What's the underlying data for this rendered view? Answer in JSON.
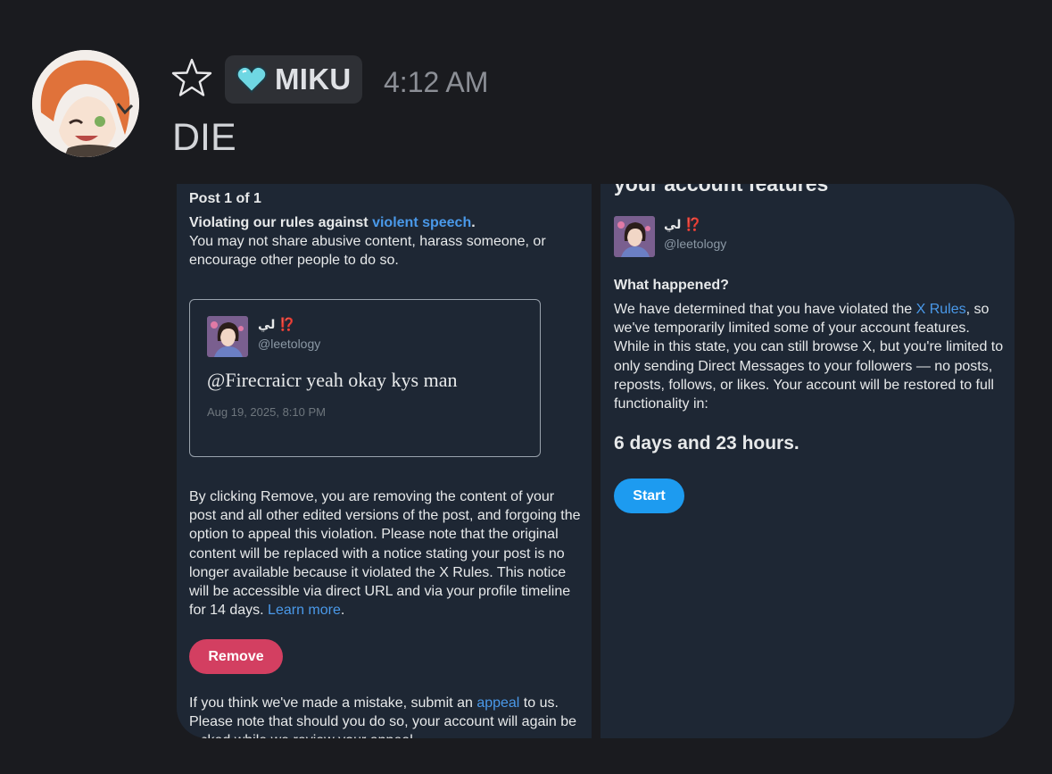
{
  "message": {
    "role_tag": "MIKU",
    "timestamp": "4:12 AM",
    "text": "DIE"
  },
  "left_panel": {
    "post_count": "Post 1 of 1",
    "violation_prefix": "Violating our rules against ",
    "violation_link": "violent speech",
    "violation_suffix": ".",
    "violation_desc": "You may not share abusive content, harass someone, or encourage other people to do so.",
    "tweet": {
      "name": "لي ⁉️",
      "handle": "@leetology",
      "text": "@Firecraicr yeah okay kys man",
      "date": "Aug 19, 2025, 8:10 PM"
    },
    "remove_info": "By clicking Remove, you are removing the content of your post and all other edited versions of the post, and forgoing the option to appeal this violation. Please note that the original content will be replaced with a notice stating your post is no longer available because it violated the X Rules. This notice will be accessible via direct URL and via your profile timeline for 14 days. ",
    "learn_more": "Learn more",
    "learn_more_suffix": ".",
    "remove_label": "Remove",
    "appeal_prefix": "If you think we've made a mistake, submit an ",
    "appeal_link": "appeal",
    "appeal_suffix": " to us. Please note that should you do so, your account will again be locked while we review your appeal."
  },
  "right_panel": {
    "cut_heading": "your account features",
    "name": "لي ⁉️",
    "handle": "@leetology",
    "what_happened": "What happened?",
    "explanation_prefix": "We have determined that you have violated the ",
    "rules_link": "X Rules",
    "explanation_suffix": ", so we've temporarily limited some of your account features. While in this state, you can still browse X, but you're limited to only sending Direct Messages to your followers — no posts, reposts, follows, or likes. Your account will be restored to full functionality in:",
    "duration": "6 days and 23 hours.",
    "start_label": "Start"
  },
  "colors": {
    "link": "#4a99e9",
    "remove": "#d33f61",
    "start": "#1d9bf0",
    "panel_bg": "#1e2734"
  }
}
